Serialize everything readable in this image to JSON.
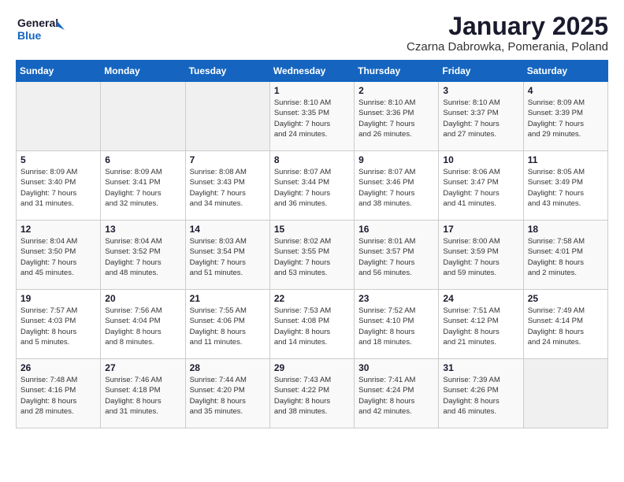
{
  "header": {
    "logo_line1": "General",
    "logo_line2": "Blue",
    "month": "January 2025",
    "location": "Czarna Dabrowka, Pomerania, Poland"
  },
  "days_of_week": [
    "Sunday",
    "Monday",
    "Tuesday",
    "Wednesday",
    "Thursday",
    "Friday",
    "Saturday"
  ],
  "weeks": [
    [
      {
        "day": "",
        "content": ""
      },
      {
        "day": "",
        "content": ""
      },
      {
        "day": "",
        "content": ""
      },
      {
        "day": "1",
        "content": "Sunrise: 8:10 AM\nSunset: 3:35 PM\nDaylight: 7 hours\nand 24 minutes."
      },
      {
        "day": "2",
        "content": "Sunrise: 8:10 AM\nSunset: 3:36 PM\nDaylight: 7 hours\nand 26 minutes."
      },
      {
        "day": "3",
        "content": "Sunrise: 8:10 AM\nSunset: 3:37 PM\nDaylight: 7 hours\nand 27 minutes."
      },
      {
        "day": "4",
        "content": "Sunrise: 8:09 AM\nSunset: 3:39 PM\nDaylight: 7 hours\nand 29 minutes."
      }
    ],
    [
      {
        "day": "5",
        "content": "Sunrise: 8:09 AM\nSunset: 3:40 PM\nDaylight: 7 hours\nand 31 minutes."
      },
      {
        "day": "6",
        "content": "Sunrise: 8:09 AM\nSunset: 3:41 PM\nDaylight: 7 hours\nand 32 minutes."
      },
      {
        "day": "7",
        "content": "Sunrise: 8:08 AM\nSunset: 3:43 PM\nDaylight: 7 hours\nand 34 minutes."
      },
      {
        "day": "8",
        "content": "Sunrise: 8:07 AM\nSunset: 3:44 PM\nDaylight: 7 hours\nand 36 minutes."
      },
      {
        "day": "9",
        "content": "Sunrise: 8:07 AM\nSunset: 3:46 PM\nDaylight: 7 hours\nand 38 minutes."
      },
      {
        "day": "10",
        "content": "Sunrise: 8:06 AM\nSunset: 3:47 PM\nDaylight: 7 hours\nand 41 minutes."
      },
      {
        "day": "11",
        "content": "Sunrise: 8:05 AM\nSunset: 3:49 PM\nDaylight: 7 hours\nand 43 minutes."
      }
    ],
    [
      {
        "day": "12",
        "content": "Sunrise: 8:04 AM\nSunset: 3:50 PM\nDaylight: 7 hours\nand 45 minutes."
      },
      {
        "day": "13",
        "content": "Sunrise: 8:04 AM\nSunset: 3:52 PM\nDaylight: 7 hours\nand 48 minutes."
      },
      {
        "day": "14",
        "content": "Sunrise: 8:03 AM\nSunset: 3:54 PM\nDaylight: 7 hours\nand 51 minutes."
      },
      {
        "day": "15",
        "content": "Sunrise: 8:02 AM\nSunset: 3:55 PM\nDaylight: 7 hours\nand 53 minutes."
      },
      {
        "day": "16",
        "content": "Sunrise: 8:01 AM\nSunset: 3:57 PM\nDaylight: 7 hours\nand 56 minutes."
      },
      {
        "day": "17",
        "content": "Sunrise: 8:00 AM\nSunset: 3:59 PM\nDaylight: 7 hours\nand 59 minutes."
      },
      {
        "day": "18",
        "content": "Sunrise: 7:58 AM\nSunset: 4:01 PM\nDaylight: 8 hours\nand 2 minutes."
      }
    ],
    [
      {
        "day": "19",
        "content": "Sunrise: 7:57 AM\nSunset: 4:03 PM\nDaylight: 8 hours\nand 5 minutes."
      },
      {
        "day": "20",
        "content": "Sunrise: 7:56 AM\nSunset: 4:04 PM\nDaylight: 8 hours\nand 8 minutes."
      },
      {
        "day": "21",
        "content": "Sunrise: 7:55 AM\nSunset: 4:06 PM\nDaylight: 8 hours\nand 11 minutes."
      },
      {
        "day": "22",
        "content": "Sunrise: 7:53 AM\nSunset: 4:08 PM\nDaylight: 8 hours\nand 14 minutes."
      },
      {
        "day": "23",
        "content": "Sunrise: 7:52 AM\nSunset: 4:10 PM\nDaylight: 8 hours\nand 18 minutes."
      },
      {
        "day": "24",
        "content": "Sunrise: 7:51 AM\nSunset: 4:12 PM\nDaylight: 8 hours\nand 21 minutes."
      },
      {
        "day": "25",
        "content": "Sunrise: 7:49 AM\nSunset: 4:14 PM\nDaylight: 8 hours\nand 24 minutes."
      }
    ],
    [
      {
        "day": "26",
        "content": "Sunrise: 7:48 AM\nSunset: 4:16 PM\nDaylight: 8 hours\nand 28 minutes."
      },
      {
        "day": "27",
        "content": "Sunrise: 7:46 AM\nSunset: 4:18 PM\nDaylight: 8 hours\nand 31 minutes."
      },
      {
        "day": "28",
        "content": "Sunrise: 7:44 AM\nSunset: 4:20 PM\nDaylight: 8 hours\nand 35 minutes."
      },
      {
        "day": "29",
        "content": "Sunrise: 7:43 AM\nSunset: 4:22 PM\nDaylight: 8 hours\nand 38 minutes."
      },
      {
        "day": "30",
        "content": "Sunrise: 7:41 AM\nSunset: 4:24 PM\nDaylight: 8 hours\nand 42 minutes."
      },
      {
        "day": "31",
        "content": "Sunrise: 7:39 AM\nSunset: 4:26 PM\nDaylight: 8 hours\nand 46 minutes."
      },
      {
        "day": "",
        "content": ""
      }
    ]
  ]
}
